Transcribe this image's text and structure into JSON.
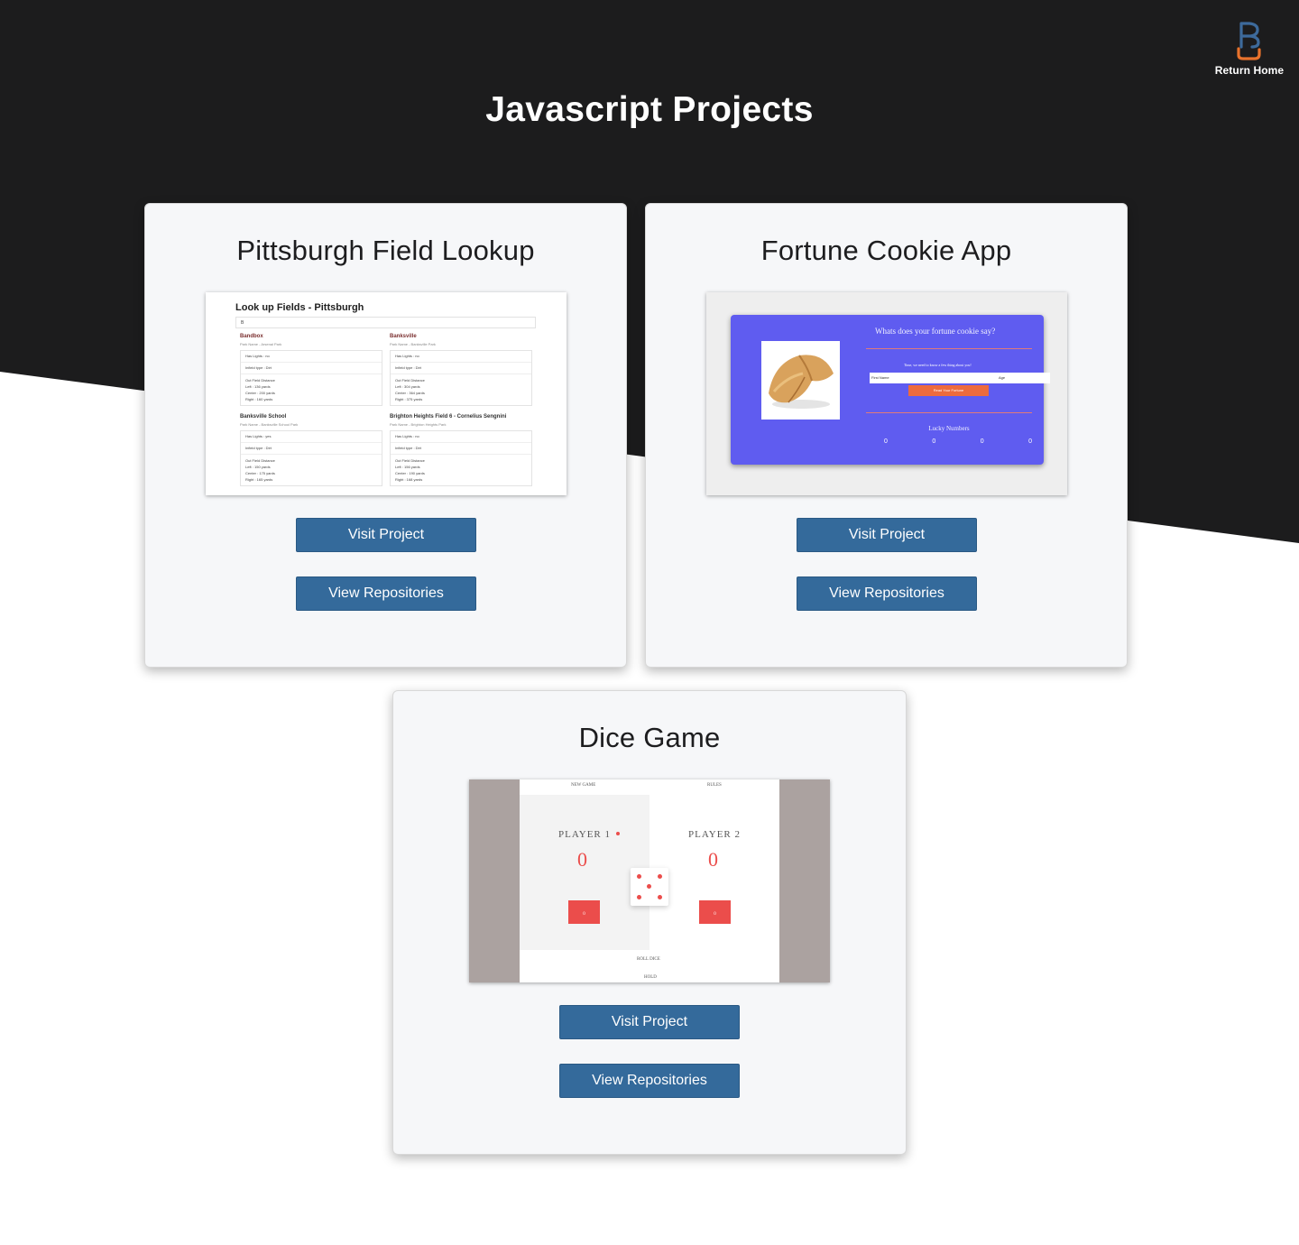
{
  "header": {
    "title": "Javascript Projects",
    "home_link_label": "Return Home",
    "logo_icon": "b-logo-icon",
    "logo_colors": [
      "#3d6a9b",
      "#e8722c"
    ]
  },
  "colors": {
    "background_dark": "#1c1c1d",
    "background_light": "#ffffff",
    "card_background": "#f6f7f9",
    "button": "#346a9b"
  },
  "projects": [
    {
      "title": "Pittsburgh Field Lookup",
      "visit_label": "Visit Project",
      "repo_label": "View Repositories",
      "preview": {
        "heading": "Look up Fields - Pittsburgh",
        "search_value": "B",
        "fields": [
          {
            "name": "Bandbox",
            "park": "Park Name - Arsenal Park",
            "lights": "Has Lights : no",
            "infield": "Infield type : Dirt",
            "distance_title": "Out Field Distance",
            "left": "Left : 136 yards",
            "center": "Center : 200 yards",
            "right": "Right : 160 yards"
          },
          {
            "name": "Banksville",
            "park": "Park Name - Banksville Park",
            "lights": "Has Lights : no",
            "infield": "Infield type : Dirt",
            "distance_title": "Out Field Distance",
            "left": "Left : 304 yards",
            "center": "Center : 364 yards",
            "right": "Right : 375 yards"
          },
          {
            "name": "Banksville School",
            "park": "Park Name - Banksville School Park",
            "lights": "Has Lights : yes",
            "infield": "Infield type : Dirt",
            "distance_title": "Out Field Distance",
            "left": "Left : 150 yards",
            "center": "Center : 175 yards",
            "right": "Right : 165 yards"
          },
          {
            "name": "Brighton Heights Field 6 - Cornelius Sengnini",
            "park": "Park Name - Brighton Heights Park",
            "lights": "Has Lights : no",
            "infield": "Infield type : Dirt",
            "distance_title": "Out Field Distance",
            "left": "Left : 156 yards",
            "center": "Center : 190 yards",
            "right": "Right : 168 yards"
          }
        ]
      }
    },
    {
      "title": "Fortune Cookie App",
      "visit_label": "Visit Project",
      "repo_label": "View Repositories",
      "preview": {
        "question": "Whats does your fortune cookie say?",
        "subtitle": "Time, we need to know a few thing about you!",
        "first_name_placeholder": "First Name",
        "age_placeholder": "Age",
        "button_label": "Read Your Fortune",
        "lucky_title": "Lucky Numbers",
        "lucky_numbers": [
          "0",
          "0",
          "0",
          "0"
        ],
        "panel_color": "#5f5cf0",
        "button_color": "#ed6b3d"
      }
    },
    {
      "title": "Dice Game",
      "visit_label": "Visit Project",
      "repo_label": "View Repositories",
      "preview": {
        "new_game": "NEW GAME",
        "rules": "RULES",
        "player1": "PLAYER 1",
        "player2": "PLAYER 2",
        "score1": "0",
        "score2": "0",
        "current1": "0",
        "current2": "0",
        "current_label": "CURRENT",
        "roll": "ROLL DICE",
        "hold": "HOLD",
        "accent_color": "#eb4d4b"
      }
    }
  ]
}
